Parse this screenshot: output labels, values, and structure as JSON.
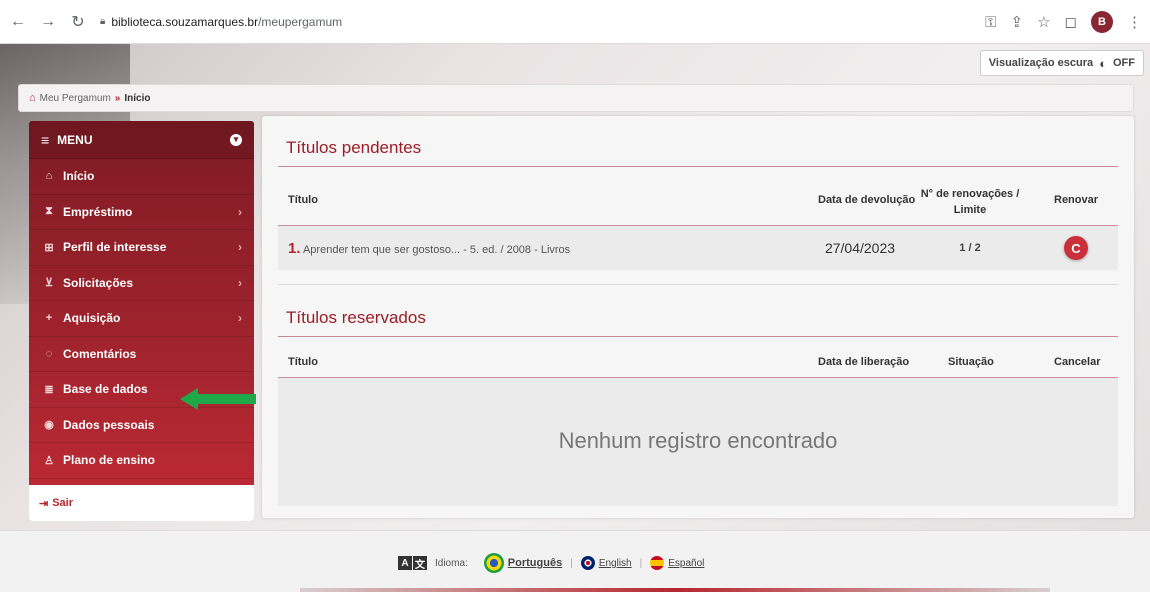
{
  "browser": {
    "url_domain": "biblioteca.souzamarques.br",
    "url_path": "/meupergamum",
    "profile_initial": "B"
  },
  "header": {
    "dark_mode_label": "Visualização escura",
    "dark_mode_state": "OFF"
  },
  "breadcrumb": {
    "root": "Meu Pergamum",
    "separator": "»",
    "current": "Início"
  },
  "sidebar": {
    "menu_label": "MENU",
    "items": [
      {
        "label": "Início",
        "icon": "home-icon",
        "has_submenu": false
      },
      {
        "label": "Empréstimo",
        "icon": "hourglass-icon",
        "has_submenu": true
      },
      {
        "label": "Perfil de interesse",
        "icon": "sitemap-icon",
        "has_submenu": true
      },
      {
        "label": "Solicitações",
        "icon": "cart-icon",
        "has_submenu": true
      },
      {
        "label": "Aquisição",
        "icon": "plus-icon",
        "has_submenu": true
      },
      {
        "label": "Comentários",
        "icon": "comment-icon",
        "has_submenu": false
      },
      {
        "label": "Base de dados",
        "icon": "database-icon",
        "has_submenu": false
      },
      {
        "label": "Dados pessoais",
        "icon": "user-circle-icon",
        "has_submenu": false
      },
      {
        "label": "Plano de ensino",
        "icon": "teacher-icon",
        "has_submenu": false
      }
    ],
    "logout_label": "Sair"
  },
  "pending": {
    "title": "Títulos pendentes",
    "columns": [
      "Título",
      "Data de devolução",
      "N° de renovações / Limite",
      "Renovar"
    ],
    "rows": [
      {
        "index": "1.",
        "title": "Aprender tem que ser gostoso... - 5. ed. / 2008 - Livros",
        "due_date": "27/04/2023",
        "renewals": "1 / 2"
      }
    ]
  },
  "reserved": {
    "title": "Títulos reservados",
    "columns": [
      "Título",
      "Data de liberação",
      "Situação",
      "Cancelar"
    ],
    "empty_message": "Nenhum registro encontrado"
  },
  "footer": {
    "language_label": "Idioma:",
    "languages": [
      "Português",
      "English",
      "Español"
    ],
    "active_language": "Português"
  },
  "colors": {
    "brand": "#b5262d",
    "highlight_arrow": "#1fa84a"
  }
}
